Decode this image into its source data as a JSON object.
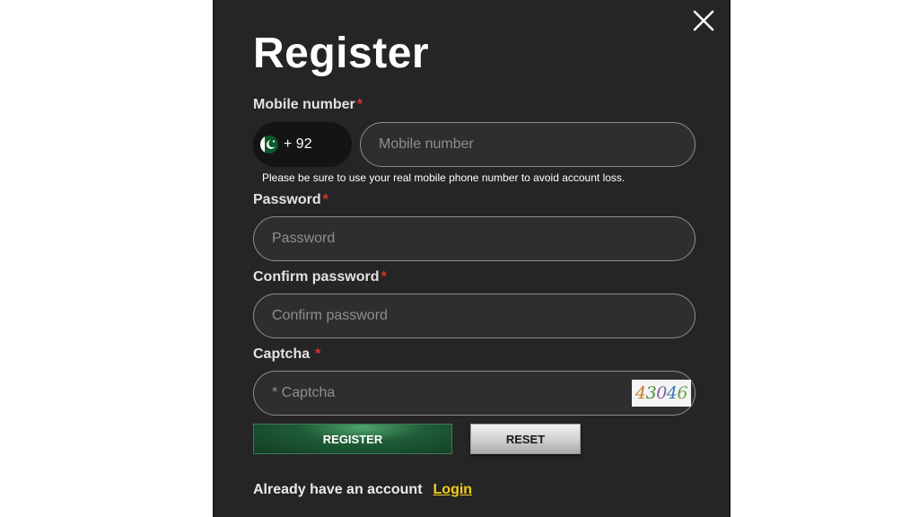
{
  "dialog": {
    "title": "Register",
    "close_icon": "close-icon"
  },
  "mobile": {
    "label": "Mobile number",
    "required_mark": "*",
    "country_flag": "pakistan-flag-icon",
    "country_code": "+ 92",
    "placeholder": "Mobile number",
    "value": "",
    "hint": "Please be sure to use your real mobile phone number to avoid account loss."
  },
  "password": {
    "label": "Password",
    "required_mark": "*",
    "placeholder": "Password",
    "value": ""
  },
  "confirm_password": {
    "label": "Confirm password",
    "required_mark": "*",
    "placeholder": "Confirm password",
    "value": ""
  },
  "captcha": {
    "label": "Captcha",
    "required_mark": "*",
    "placeholder": "* Captcha",
    "value": "",
    "image_digits": [
      "4",
      "3",
      "0",
      "4",
      "6"
    ]
  },
  "actions": {
    "register_label": "REGISTER",
    "reset_label": "RESET"
  },
  "footer": {
    "question": "Already have an account",
    "login_link": "Login"
  },
  "colors": {
    "modal_bg": "#252525",
    "required": "#d9342b",
    "link": "#f2cc1b",
    "register_green": "#1f5c37"
  }
}
